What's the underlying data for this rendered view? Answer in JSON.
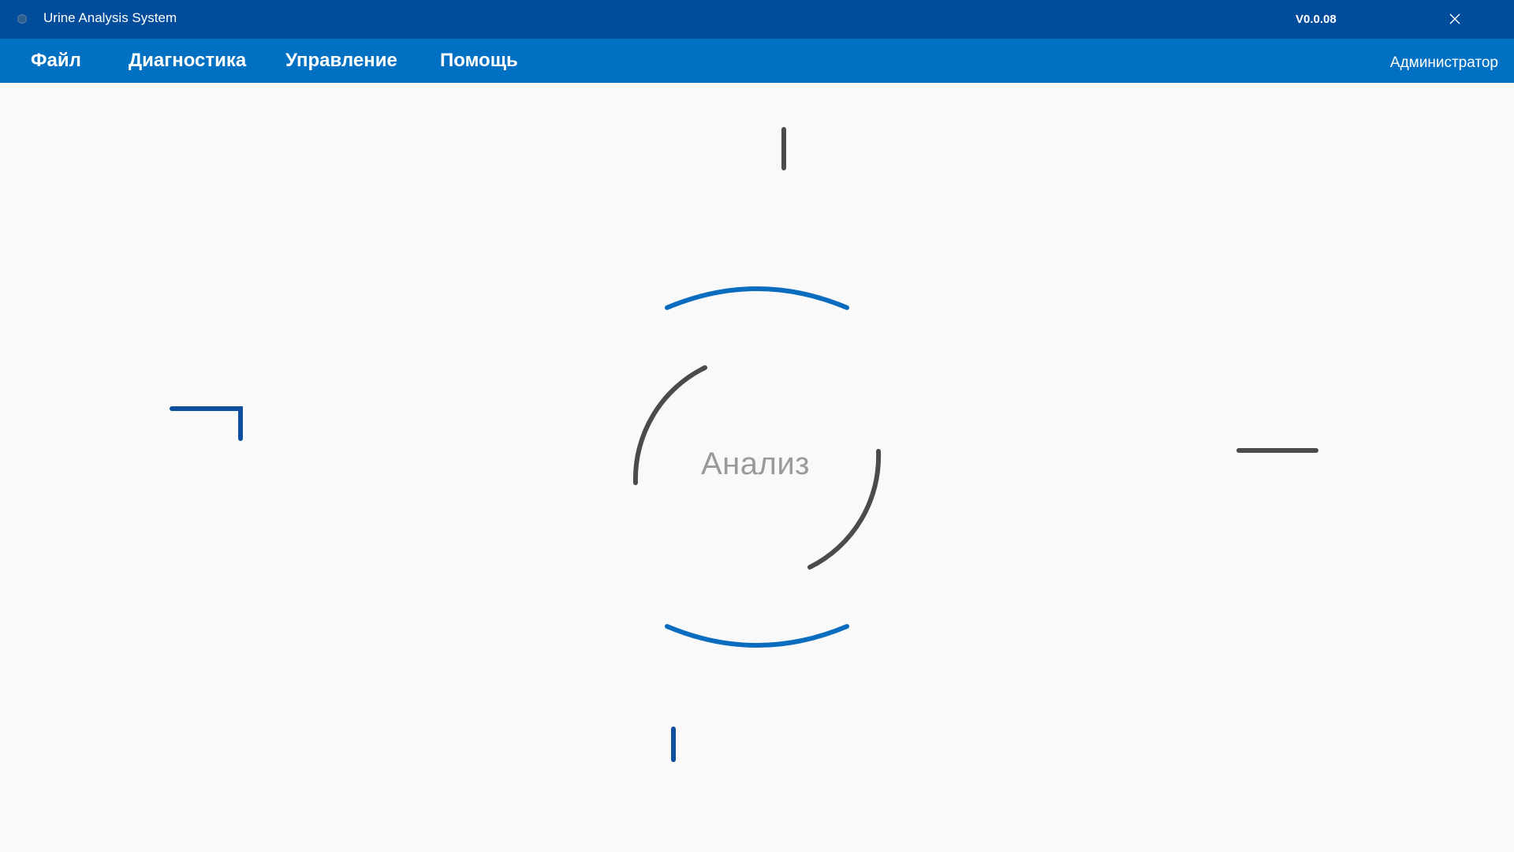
{
  "window": {
    "title": "Urine Analysis System",
    "version": "V0.0.08",
    "close_icon": "close-icon"
  },
  "menu": {
    "items": [
      {
        "label": "Файл"
      },
      {
        "label": "Диагностика"
      },
      {
        "label": "Управление"
      },
      {
        "label": "Помощь"
      }
    ],
    "user": "Администратор"
  },
  "main": {
    "analyze_label": "Анализ"
  },
  "colors": {
    "titlebar": "#014d9c",
    "menubar": "#0070c2",
    "background": "#f9f9f9",
    "accent_blue": "#0a6cbf",
    "dark_blue": "#0d4f9e",
    "dark_gray": "#4b4b4b",
    "label_gray": "#9a9a9a"
  }
}
